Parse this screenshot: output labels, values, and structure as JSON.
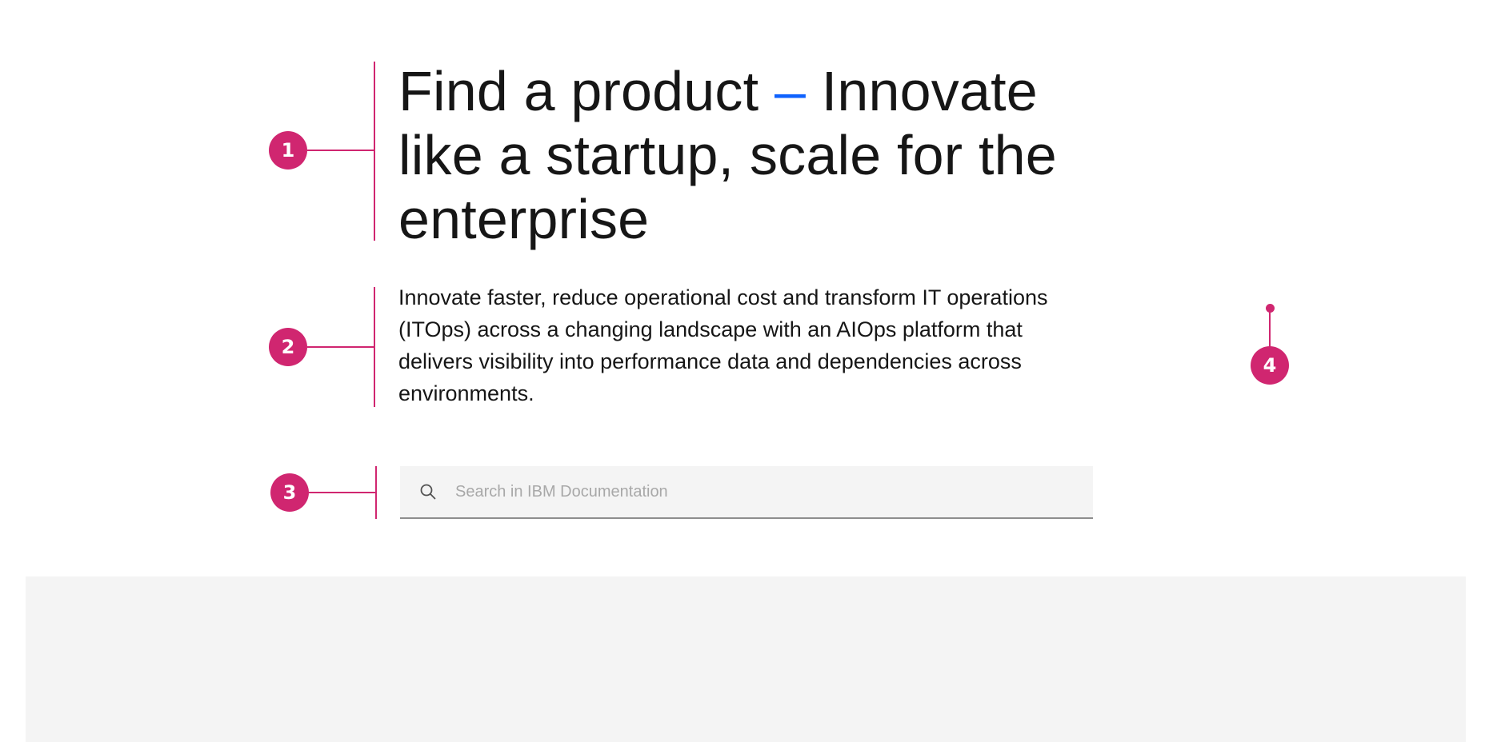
{
  "hero": {
    "title_part1": "Find a product ",
    "title_dash": "–",
    "title_part2": " Innovate like a startup, scale for the enterprise",
    "description": "Innovate faster, reduce operational cost and transform IT operations (ITOps) across a changing landscape with an AIOps platform that delivers visibility into performance data and dependencies across environments."
  },
  "search": {
    "icon": "search-icon",
    "value": "",
    "placeholder": "Search in IBM Documentation"
  },
  "annotations": [
    {
      "label": "1"
    },
    {
      "label": "2"
    },
    {
      "label": "3"
    },
    {
      "label": "4"
    }
  ],
  "colors": {
    "annotation": "#d02670",
    "accent": "#0f62fe",
    "text": "#161616",
    "field_bg": "#f4f4f4",
    "placeholder": "#a8a8a8"
  }
}
